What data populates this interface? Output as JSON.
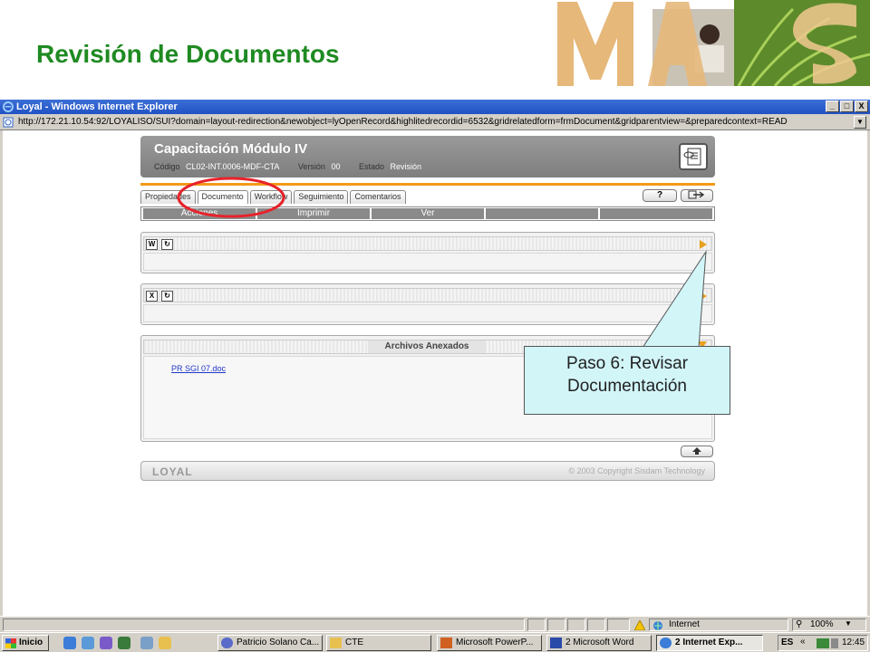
{
  "slide": {
    "title": "Revisión de Documentos"
  },
  "window": {
    "title": "Loyal - Windows Internet Explorer",
    "minimize": "_",
    "maximize": "□",
    "close": "X",
    "address": "http://172.21.10.54:92/LOYALISO/SUI?domain=layout-redirection&newobject=lyOpenRecord&highlitedrecordid=6532&gridrelatedform=frmDocument&gridparentview=&preparedcontext=READ"
  },
  "app": {
    "title": "Capacitación Módulo IV",
    "codigo_label": "Código",
    "codigo": "CL02-INT.0006-MDF-CTA",
    "version_label": "Versión",
    "version": "00",
    "estado_label": "Estado",
    "estado": "Revisión",
    "tabs": [
      {
        "label": "Propiedades"
      },
      {
        "label": "Documento"
      },
      {
        "label": "Workflow"
      },
      {
        "label": "Seguimiento"
      },
      {
        "label": "Comentarios"
      }
    ],
    "help_label": "?",
    "actions": [
      {
        "label": "Acciones"
      },
      {
        "label": "Imprimir"
      },
      {
        "label": "Ver"
      },
      {
        "label": ""
      },
      {
        "label": ""
      }
    ],
    "word_icon_label": "W",
    "excel_icon_label": "X",
    "refresh_icon_label": "↻",
    "attachments_title": "Archivos Anexados",
    "attachment_file": "PR SGI 07.doc",
    "footer_logo": "LOYAL",
    "footer_copyright": "© 2003 Copyright Sisdam Technology"
  },
  "callout": {
    "line1": "Paso 6: Revisar",
    "line2": "Documentación"
  },
  "statusbar": {
    "zone": "Internet",
    "zoom": "100%"
  },
  "taskbar": {
    "start": "Inicio",
    "items": [
      {
        "label": "Patricio Solano Ca..."
      },
      {
        "label": "CTE"
      },
      {
        "label": "Microsoft PowerP..."
      },
      {
        "label": "2 Microsoft Word"
      },
      {
        "label": "2 Internet Exp..."
      }
    ],
    "lang": "ES",
    "chevron": "«",
    "time": "12:45"
  },
  "colors": {
    "title_green": "#1f8a22",
    "accent_orange": "#f29a1a",
    "highlight_red": "#e8222a",
    "callout_bg": "#d2f5f8",
    "ie_blue": "#2052c4"
  }
}
